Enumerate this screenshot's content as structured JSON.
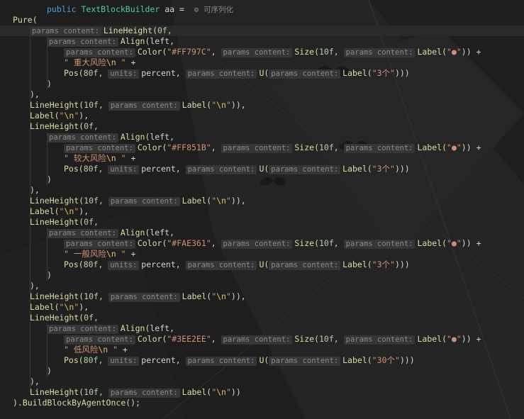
{
  "code": {
    "decl_kw": "public",
    "decl_type": "TextBlockBuilder",
    "decl_var": "aa",
    "decl_eq": "=",
    "lens_icon": "gear-icon",
    "lens_text": "可序列化",
    "pure": "Pure(",
    "hint_params": "params content:",
    "hint_units": "units:",
    "line_height": "LineHeight(",
    "align": "Align(",
    "left": "left,",
    "color": "Color(",
    "size": "Size(",
    "label": "Label(",
    "pos": "Pos(",
    "u": "U(",
    "percent": "percent,",
    "n0f": "0f,",
    "n10f": "10f,",
    "n80f": "80f,",
    "bullet_str": "\"●\"",
    "bullet_close": ")) +",
    "newline_str_open": "\"",
    "newline_esc": "\\n",
    "newline_str_close": "\"",
    "close_paren": ")",
    "close_paren_comma": "),",
    "close_paren_paren": ")),",
    "label_close": "),",
    "final_close": ")",
    "plus": " +",
    "build": ").BuildBlockByAgentOnce();",
    "blocks": [
      {
        "color_str": "\"#FF797C\"",
        "text_pre": "\" 重大风险",
        "count": "\"3个\""
      },
      {
        "color_str": "\"#FF851B\"",
        "text_pre": "\" 较大风险",
        "count": "\"3个\""
      },
      {
        "color_str": "\"#FAE361\"",
        "text_pre": "\" 一般风险",
        "count": "\"3个\""
      },
      {
        "color_str": "\"#3EE2EE\"",
        "text_pre": "\" 低风险",
        "count": "\"30个\""
      }
    ]
  },
  "colors": {
    "background": "#1e1e1e",
    "keyword": "#569cd6",
    "type": "#4ec9b0",
    "method": "#dcdcaa",
    "string": "#ce9178",
    "number": "#b5cea8",
    "hint_bg": "#363636"
  }
}
